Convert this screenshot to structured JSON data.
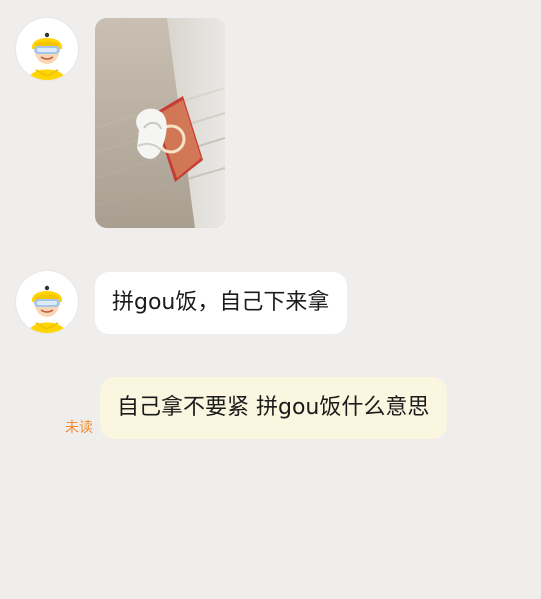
{
  "colors": {
    "background": "#efeeed",
    "incoming_bubble": "#ffffff",
    "outgoing_bubble": "#fbf6df",
    "unread": "#f58a2c",
    "avatar_helmet": "#ffd400"
  },
  "messages": [
    {
      "type": "image",
      "side": "left",
      "avatar": "rider-avatar-icon",
      "image": "delivery-photo-icon"
    },
    {
      "type": "text",
      "side": "left",
      "avatar": "rider-avatar-icon",
      "text": "拼gou饭，自己下来拿"
    },
    {
      "type": "text",
      "side": "right",
      "text": "自己拿不要紧 拼gou饭什么意思",
      "status": "未读"
    }
  ]
}
